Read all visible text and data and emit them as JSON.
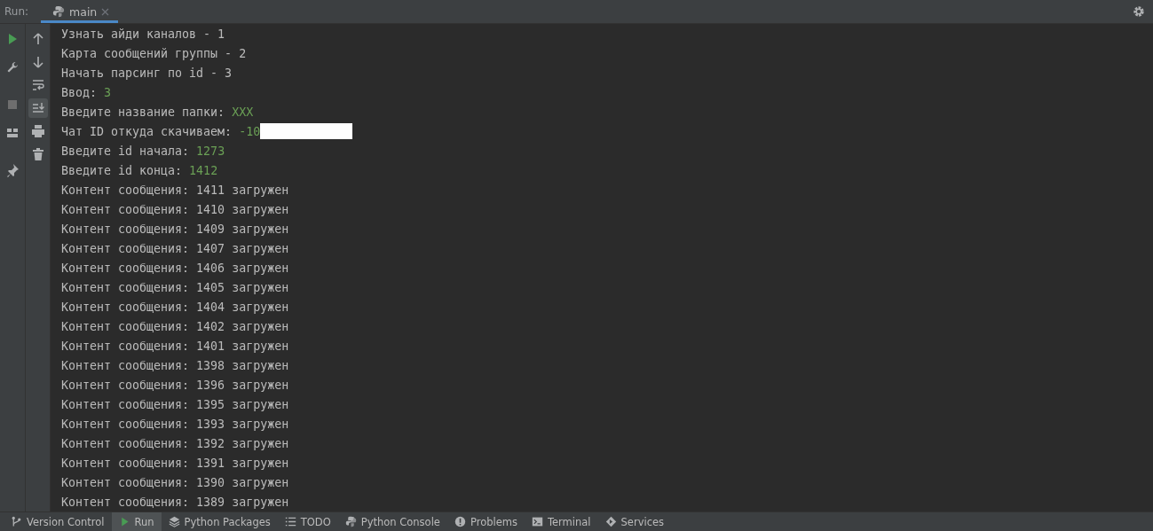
{
  "run_bar": {
    "label": "Run:",
    "tabs": [
      {
        "label": "main",
        "selected": true
      }
    ]
  },
  "left_toolbar": [
    {
      "kind": "play"
    },
    {
      "kind": "wrench"
    },
    {
      "kind": "stop"
    },
    {
      "kind": "layout"
    },
    {
      "kind": "pin"
    }
  ],
  "console_toolbar": [
    {
      "kind": "up",
      "selected": false
    },
    {
      "kind": "down",
      "selected": false
    },
    {
      "kind": "wrap",
      "selected": false
    },
    {
      "kind": "scroll-end",
      "selected": true
    },
    {
      "kind": "print",
      "selected": false
    },
    {
      "kind": "trash",
      "selected": false
    }
  ],
  "console_lines": [
    {
      "text": "Узнать айди каналов - 1"
    },
    {
      "text": "Карта сообщений группы - 2"
    },
    {
      "text": "Начать парсинг по id - 3"
    },
    {
      "text": "Ввод: ",
      "input": "3"
    },
    {
      "text": "Введите название папки: ",
      "input": "XXX"
    },
    {
      "text": "Чат ID откуда скачиваем: ",
      "input": "-10",
      "redacted": true
    },
    {
      "text": "Введите id начала: ",
      "input": "1273"
    },
    {
      "text": "Введите id конца: ",
      "input": "1412"
    },
    {
      "text": "Контент сообщения: 1411 загружен"
    },
    {
      "text": "Контент сообщения: 1410 загружен"
    },
    {
      "text": "Контент сообщения: 1409 загружен"
    },
    {
      "text": "Контент сообщения: 1407 загружен"
    },
    {
      "text": "Контент сообщения: 1406 загружен"
    },
    {
      "text": "Контент сообщения: 1405 загружен"
    },
    {
      "text": "Контент сообщения: 1404 загружен"
    },
    {
      "text": "Контент сообщения: 1402 загружен"
    },
    {
      "text": "Контент сообщения: 1401 загружен"
    },
    {
      "text": "Контент сообщения: 1398 загружен"
    },
    {
      "text": "Контент сообщения: 1396 загружен"
    },
    {
      "text": "Контент сообщения: 1395 загружен"
    },
    {
      "text": "Контент сообщения: 1393 загружен"
    },
    {
      "text": "Контент сообщения: 1392 загружен"
    },
    {
      "text": "Контент сообщения: 1391 загружен"
    },
    {
      "text": "Контент сообщения: 1390 загружен"
    },
    {
      "text": "Контент сообщения: 1389 загружен"
    }
  ],
  "bottom_tabs": [
    {
      "kind": "branch",
      "label": "Version Control",
      "selected": false
    },
    {
      "kind": "play",
      "label": "Run",
      "selected": true
    },
    {
      "kind": "layers",
      "label": "Python Packages",
      "selected": false
    },
    {
      "kind": "list",
      "label": "TODO",
      "selected": false
    },
    {
      "kind": "python",
      "label": "Python Console",
      "selected": false
    },
    {
      "kind": "alert",
      "label": "Problems",
      "selected": false
    },
    {
      "kind": "terminal",
      "label": "Terminal",
      "selected": false
    },
    {
      "kind": "services",
      "label": "Services",
      "selected": false
    }
  ]
}
